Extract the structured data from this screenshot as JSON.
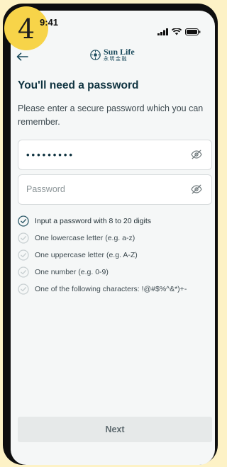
{
  "step_number": "4",
  "status_bar": {
    "time": "9:41"
  },
  "brand": {
    "name": "Sun Life",
    "chinese_name": "永明金融"
  },
  "page": {
    "title": "You'll need a password",
    "subtitle": "Please enter a secure password which you can remember."
  },
  "password_field": {
    "value": "•••••••••"
  },
  "confirm_field": {
    "placeholder": "Password",
    "value": ""
  },
  "requirements": [
    {
      "label": "Input a password with 8 to 20 digits",
      "met": true
    },
    {
      "label": "One lowercase letter (e.g. a-z)",
      "met": false
    },
    {
      "label": "One uppercase letter (e.g. A-Z)",
      "met": false
    },
    {
      "label": "One number (e.g. 0-9)",
      "met": false
    },
    {
      "label": "One of the following characters: !@#$%^&*)+-",
      "met": false
    }
  ],
  "actions": {
    "next_label": "Next"
  },
  "icons": {
    "back": "arrow-left-icon",
    "visibility": "eye-off-icon",
    "requirement": "check-circle-icon"
  },
  "colors": {
    "brand_teal": "#1b4a5c",
    "badge_yellow": "#f7d449",
    "background_cream": "#fdf2c6",
    "check_met": "#2f5b6a",
    "check_unmet": "#c9d0d2",
    "button_disabled": "#e6e9e9"
  }
}
